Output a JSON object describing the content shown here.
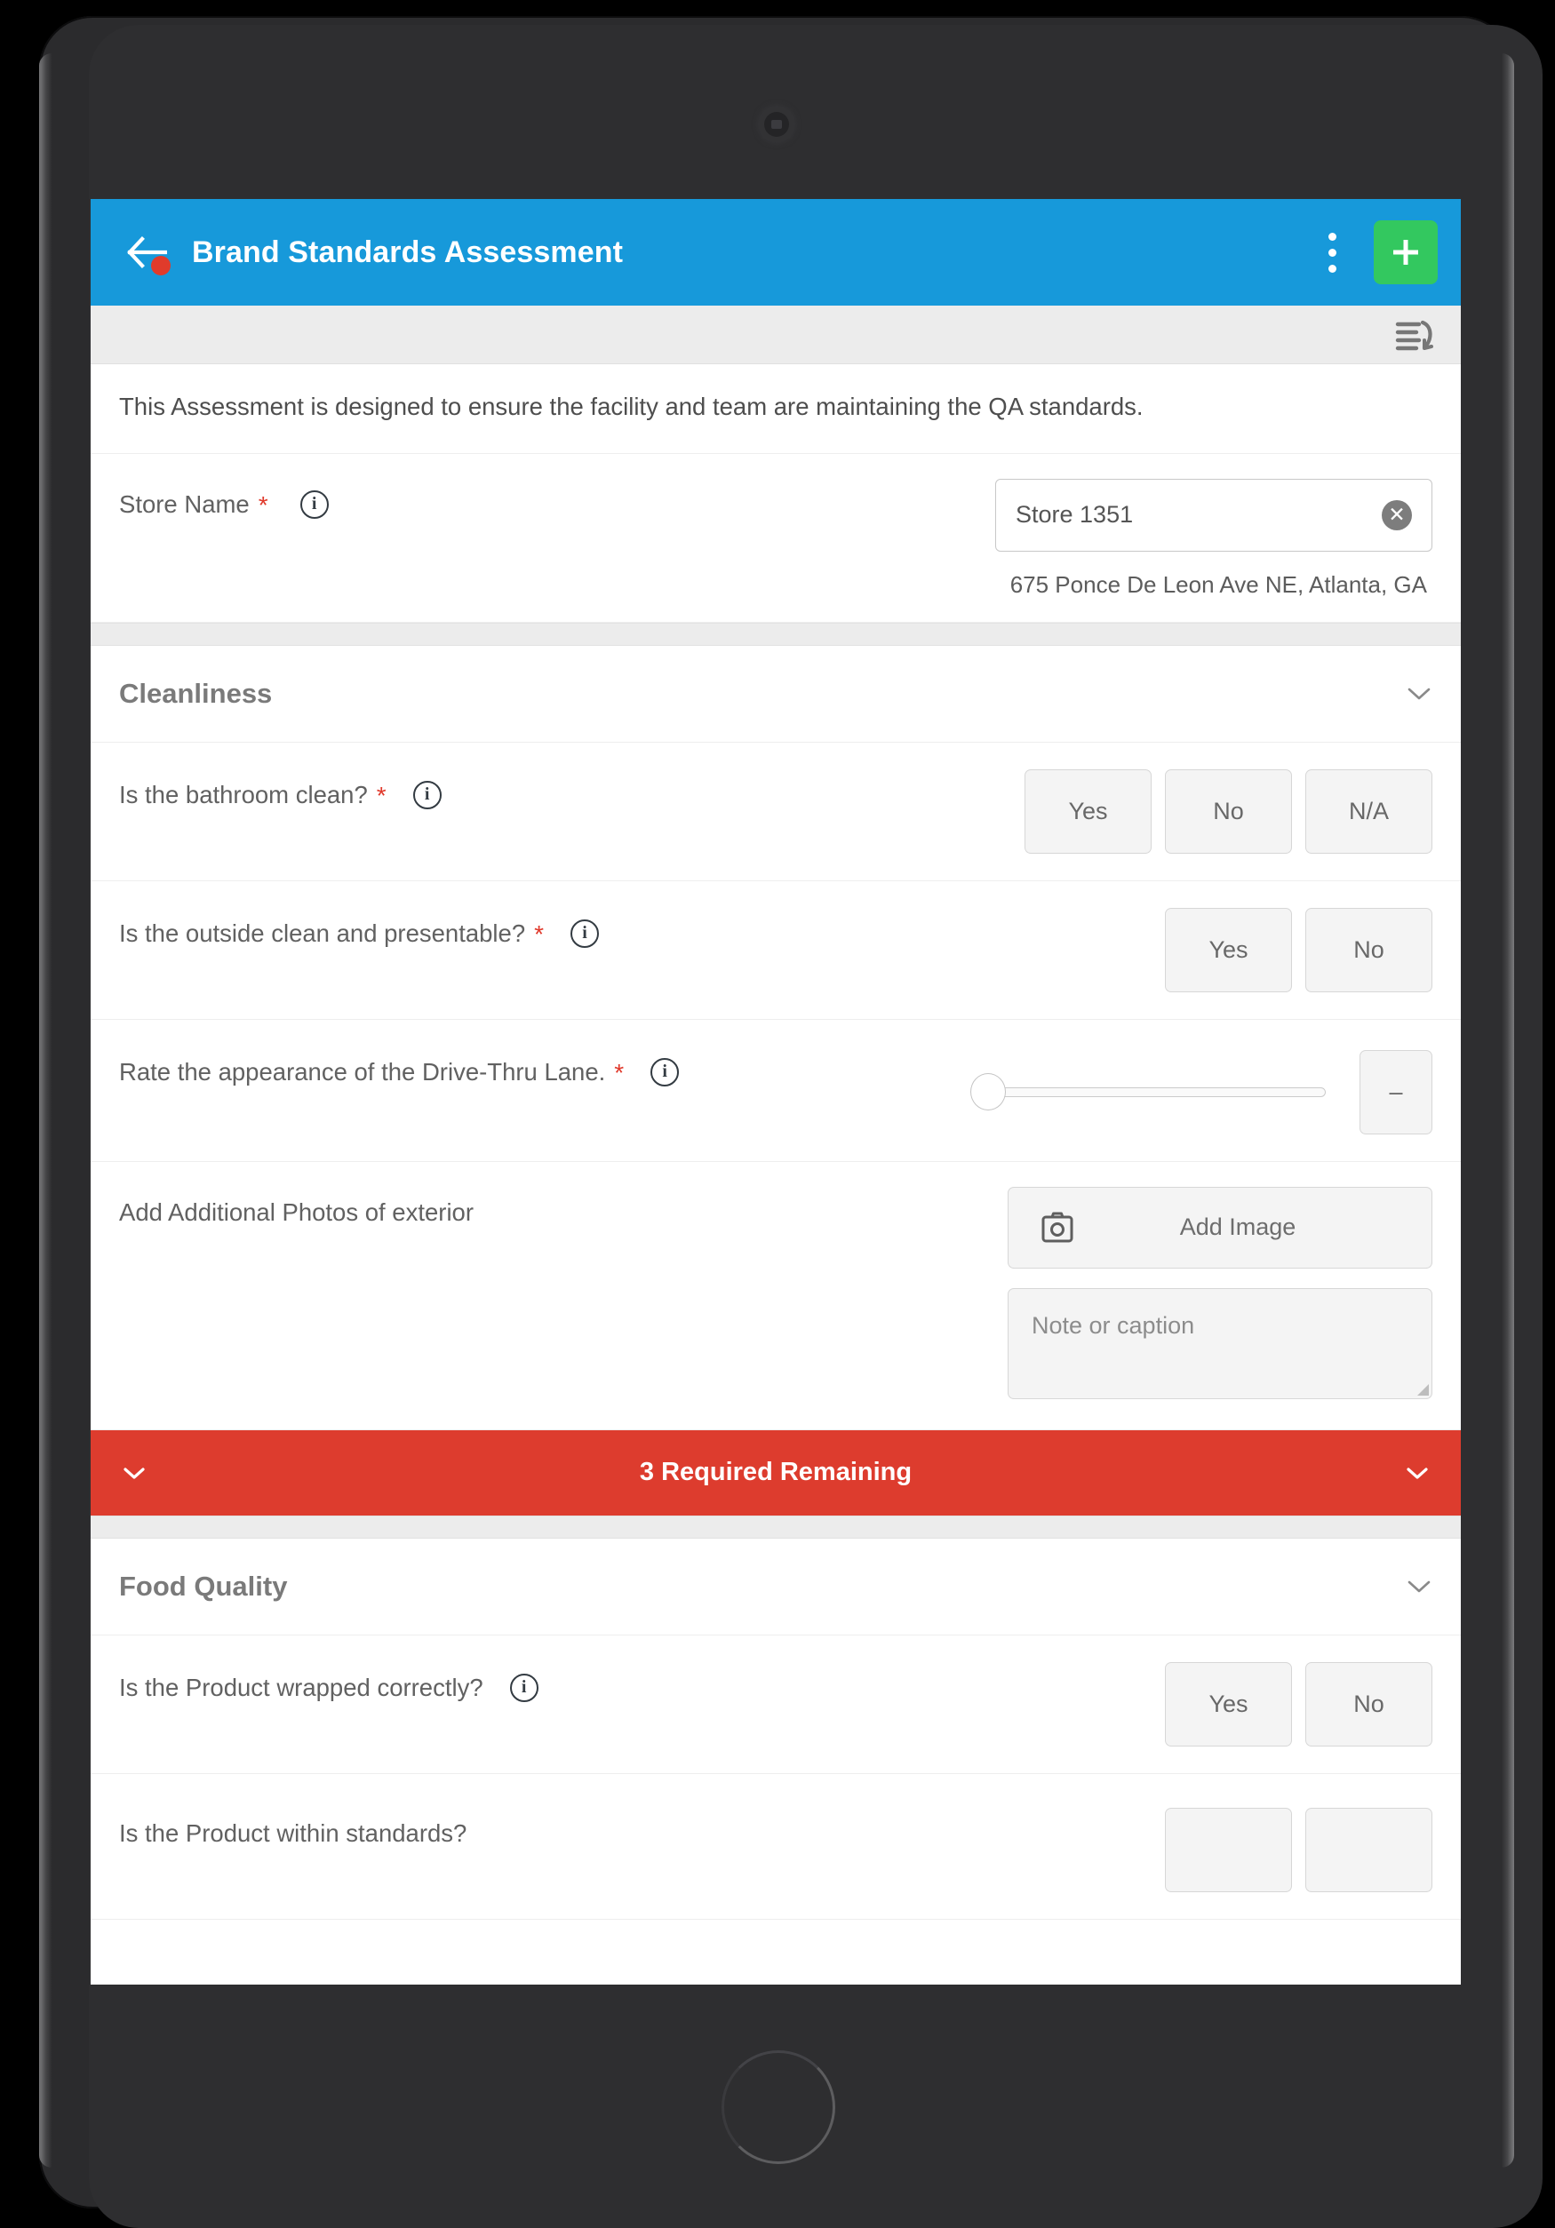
{
  "app_bar": {
    "title": "Brand Standards Assessment",
    "back_icon": "arrow-left-icon",
    "badge_color": "#e03b2b",
    "overflow_icon": "kebab-menu-icon",
    "add_icon": "plus-icon",
    "add_button_color": "#33c85f",
    "background_color": "#1799da"
  },
  "sub_toolbar": {
    "jump_icon": "jump-to-section-icon"
  },
  "intro": {
    "text": "This Assessment is designed to ensure the facility and team are maintaining the QA standards."
  },
  "store_name": {
    "label": "Store Name",
    "required_marker": "*",
    "info_icon": "info-icon",
    "value": "Store 1351",
    "placeholder": "Store Name",
    "clear_icon": "clear-icon",
    "address": "675 Ponce De Leon Ave NE,  Atlanta, GA"
  },
  "sections": [
    {
      "title": "Cleanliness",
      "collapse_icon": "chevron-down-icon",
      "questions": [
        {
          "label": "Is the bathroom clean?",
          "required_marker": "*",
          "info_icon": "info-icon",
          "type": "choice",
          "options": [
            "Yes",
            "No",
            "N/A"
          ]
        },
        {
          "label": "Is the outside clean and presentable?",
          "required_marker": "*",
          "info_icon": "info-icon",
          "type": "choice",
          "options": [
            "Yes",
            "No"
          ]
        },
        {
          "label": "Rate the appearance of the Drive-Thru Lane.",
          "required_marker": "*",
          "info_icon": "info-icon",
          "type": "slider",
          "slider_value": "–",
          "slider_position_pct": 0
        },
        {
          "label": "Add Additional Photos of exterior",
          "required_marker": "",
          "type": "photo",
          "add_image_label": "Add Image",
          "camera_icon": "camera-icon",
          "note_placeholder": "Note or caption"
        }
      ]
    }
  ],
  "required_banner": {
    "text": "3 Required Remaining",
    "left_icon": "chevron-down-icon",
    "right_icon": "chevron-down-icon",
    "background_color": "#dd3c2e"
  },
  "section_two": {
    "title": "Food Quality",
    "collapse_icon": "chevron-down-icon",
    "questions": [
      {
        "label": "Is the Product wrapped correctly?",
        "info_icon": "info-icon",
        "options": [
          "Yes",
          "No"
        ]
      },
      {
        "label": "Is the Product within standards?",
        "options": [
          "",
          ""
        ]
      }
    ]
  },
  "device": {
    "camera_icon": "front-camera-icon",
    "home_button_icon": "home-button-icon"
  }
}
